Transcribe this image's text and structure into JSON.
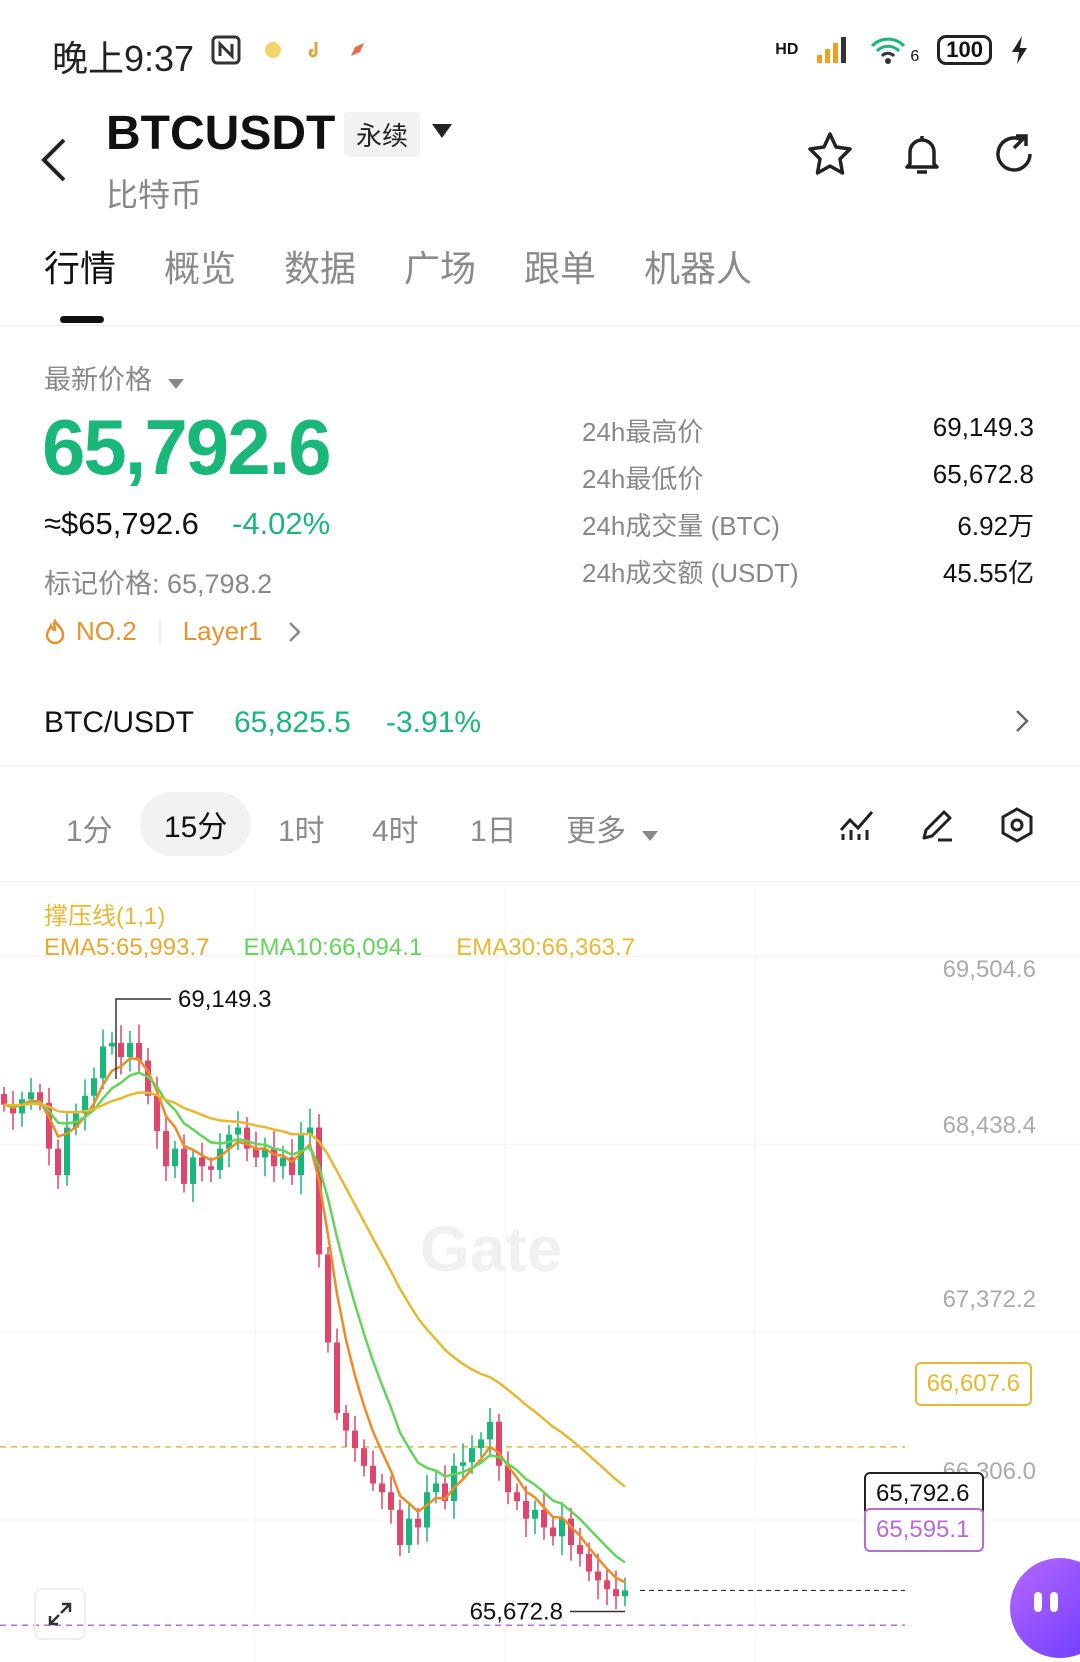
{
  "status_bar": {
    "time": "晚上9:37",
    "battery": "100",
    "network": "HD",
    "wifi_label": "6"
  },
  "header": {
    "pair": "BTCUSDT",
    "contract_type": "永续",
    "subtitle": "比特币"
  },
  "tabs": [
    {
      "label": "行情"
    },
    {
      "label": "概览"
    },
    {
      "label": "数据"
    },
    {
      "label": "广场"
    },
    {
      "label": "跟单"
    },
    {
      "label": "机器人"
    }
  ],
  "price": {
    "latest_label": "最新价格",
    "latest_price": "65,792.6",
    "usd_price": "≈$65,792.6",
    "change_pct": "-4.02%",
    "mark_price": "标记价格: 65,798.2",
    "rank": "NO.2",
    "tag": "Layer1"
  },
  "stats": [
    {
      "label": "24h最高价",
      "value": "69,149.3"
    },
    {
      "label": "24h最低价",
      "value": "65,672.8"
    },
    {
      "label": "24h成交量 (BTC)",
      "value": "6.92万"
    },
    {
      "label": "24h成交额 (USDT)",
      "value": "45.55亿"
    }
  ],
  "spot": {
    "pair": "BTC/USDT",
    "price": "65,825.5",
    "change": "-3.91%"
  },
  "intervals": [
    {
      "label": "1分"
    },
    {
      "label": "15分"
    },
    {
      "label": "1时"
    },
    {
      "label": "4时"
    },
    {
      "label": "1日"
    },
    {
      "label": "更多"
    }
  ],
  "chart": {
    "indicator_title": "撑压线(1,1)",
    "ema5": "EMA5:65,993.7",
    "ema10": "EMA10:66,094.1",
    "ema30": "EMA30:66,363.7",
    "y_labels": [
      "69,504.6",
      "68,438.4",
      "67,372.2",
      "66,306.0"
    ],
    "high_label": "69,149.3",
    "low_label": "65,672.8",
    "resistance_tag": "66,607.6",
    "current_tag": "65,792.6",
    "support_tag": "65,595.1",
    "watermark": "Gate",
    "colors": {
      "up": "#19b77a",
      "down": "#e0466a",
      "ema5": "#f08a24",
      "ema10": "#62d45a",
      "ema30": "#e8b830",
      "support": "#b86ad6"
    }
  },
  "chart_data": {
    "type": "candlestick",
    "interval": "15分",
    "ylim": [
      65500,
      69700
    ],
    "y_ticks": [
      69504.6,
      68438.4,
      67372.2,
      66306.0
    ],
    "high": 69149.3,
    "low": 65672.8,
    "last": 65792.6,
    "resistance": 66607.6,
    "support": 65595.1,
    "ema": {
      "EMA5": 65993.7,
      "EMA10": 66094.1,
      "EMA30": 66363.7
    },
    "closes": [
      68550,
      68500,
      68580,
      68620,
      68560,
      68300,
      68150,
      68420,
      68500,
      68600,
      68700,
      68880,
      68900,
      68820,
      68900,
      68800,
      68600,
      68400,
      68200,
      68300,
      68100,
      68250,
      68200,
      68180,
      68300,
      68380,
      68420,
      68300,
      68250,
      68300,
      68200,
      68250,
      68150,
      68380,
      68420,
      67700,
      67200,
      66800,
      66700,
      66600,
      66500,
      66400,
      66350,
      66250,
      66050,
      66200,
      66150,
      66350,
      66400,
      66300,
      66500,
      66520,
      66600,
      66650,
      66750,
      66500,
      66350,
      66300,
      66200,
      66250,
      66150,
      66100,
      66200,
      66050,
      66000,
      65900,
      65850,
      65800,
      65760,
      65792.6
    ]
  }
}
